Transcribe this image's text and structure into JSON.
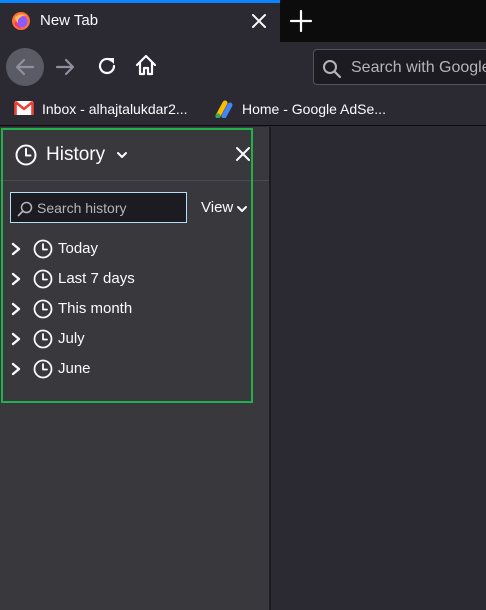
{
  "tab": {
    "title": "New Tab",
    "favicon": "firefox-logo",
    "close_icon": "close-icon"
  },
  "new_tab_icon": "plus-icon",
  "nav": {
    "back_icon": "back-arrow-icon",
    "forward_icon": "forward-arrow-icon",
    "reload_icon": "reload-icon",
    "home_icon": "home-icon"
  },
  "urlbar": {
    "placeholder": "Search with Google",
    "icon": "search-icon"
  },
  "bookmarks": [
    {
      "label": "Inbox - alhajtalukdar2...",
      "icon": "gmail-icon"
    },
    {
      "label": "Home - Google AdSe...",
      "icon": "adsense-icon"
    }
  ],
  "sidebar": {
    "title": "History",
    "title_icon": "clock-icon",
    "search_placeholder": "Search history",
    "view_label": "View",
    "items": [
      {
        "label": "Today"
      },
      {
        "label": "Last 7 days"
      },
      {
        "label": "This month"
      },
      {
        "label": "July"
      },
      {
        "label": "June"
      }
    ]
  },
  "colors": {
    "tab_accent": "#0a84ff",
    "highlight": "#21b14a",
    "toolbar": "#2b2a33",
    "sidebar": "#38383d"
  }
}
